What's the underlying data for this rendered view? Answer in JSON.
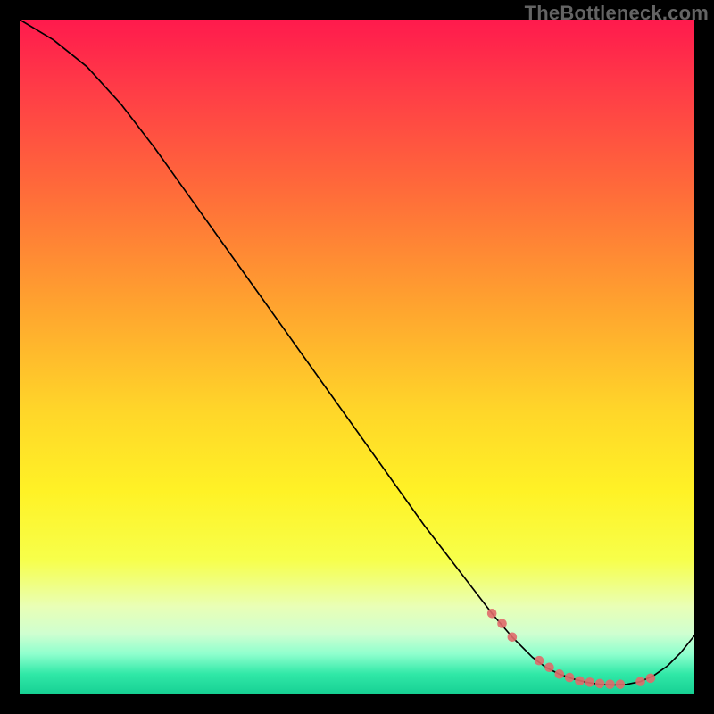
{
  "watermark": "TheBottleneck.com",
  "chart_data": {
    "type": "line",
    "title": "",
    "xlabel": "",
    "ylabel": "",
    "xlim": [
      0,
      100
    ],
    "ylim": [
      0,
      100
    ],
    "grid": false,
    "legend": false,
    "series": [
      {
        "name": "curve",
        "x": [
          0,
          5,
          10,
          15,
          20,
          25,
          30,
          35,
          40,
          45,
          50,
          55,
          60,
          65,
          70,
          73,
          76,
          78,
          80,
          82,
          84,
          86,
          88,
          90,
          92,
          94,
          96,
          98,
          100
        ],
        "y": [
          100,
          97,
          93,
          87.5,
          81,
          74,
          67,
          60,
          53,
          46,
          39,
          32,
          25,
          18.5,
          12,
          8.5,
          5.5,
          4,
          3,
          2.3,
          1.8,
          1.5,
          1.4,
          1.5,
          1.9,
          2.8,
          4.2,
          6.2,
          8.7
        ]
      }
    ],
    "markers": {
      "name": "dots",
      "x": [
        70,
        71.5,
        73,
        77,
        78.5,
        80,
        81.5,
        83,
        84.5,
        86,
        87.5,
        89,
        92,
        93.5
      ],
      "y": [
        12,
        10.5,
        8.5,
        5,
        4,
        3,
        2.5,
        2,
        1.8,
        1.6,
        1.5,
        1.5,
        1.9,
        2.4
      ]
    },
    "gradient_stops": [
      {
        "pos": 0.0,
        "color": "#ff1a4d"
      },
      {
        "pos": 0.1,
        "color": "#ff3b47"
      },
      {
        "pos": 0.25,
        "color": "#ff6a3a"
      },
      {
        "pos": 0.42,
        "color": "#ffa22f"
      },
      {
        "pos": 0.58,
        "color": "#ffd629"
      },
      {
        "pos": 0.7,
        "color": "#fff226"
      },
      {
        "pos": 0.8,
        "color": "#f7ff4a"
      },
      {
        "pos": 0.87,
        "color": "#e9ffb6"
      },
      {
        "pos": 0.91,
        "color": "#cfffd0"
      },
      {
        "pos": 0.94,
        "color": "#8fffce"
      },
      {
        "pos": 0.97,
        "color": "#30e8a7"
      },
      {
        "pos": 0.99,
        "color": "#1fd89a"
      },
      {
        "pos": 1.0,
        "color": "#16cf92"
      }
    ]
  }
}
